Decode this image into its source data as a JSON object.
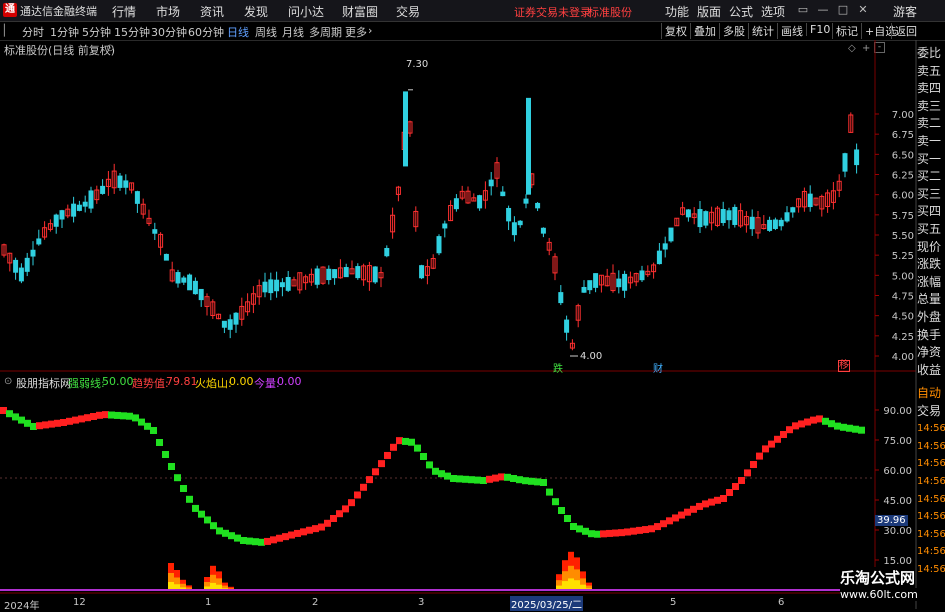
{
  "menubar": {
    "app_title": "通达信金融终端",
    "items": [
      "行情",
      "市场",
      "资讯",
      "发现",
      "问小达",
      "财富圈",
      "交易"
    ],
    "broker_status": "证券交易未登录",
    "broker_name": "标准股份",
    "right_items": [
      "功能",
      "版面",
      "公式",
      "选项"
    ],
    "guest": "游客"
  },
  "toolbar": {
    "periods": [
      "分时",
      "1分钟",
      "5分钟",
      "15分钟",
      "30分钟",
      "60分钟",
      "日线",
      "周线",
      "月线",
      "多周期",
      "更多"
    ],
    "active_period": "日线",
    "right_buttons": [
      "复权",
      "叠加",
      "多股",
      "统计",
      "画线",
      "F10",
      "标记",
      "+自选",
      "返回"
    ]
  },
  "main_chart": {
    "label": "标准股份(日线 前复权)",
    "y_ticks": [
      "7.00",
      "6.75",
      "6.50",
      "6.25",
      "6.00",
      "5.75",
      "5.50",
      "5.25",
      "5.00",
      "4.75",
      "4.50",
      "4.25",
      "4.00"
    ],
    "high_marker": "7.30",
    "low_marker": "4.00",
    "events": [
      {
        "text": "跌",
        "color": "#40e040"
      },
      {
        "text": "财",
        "color": "#40b0ff"
      },
      {
        "text": "移",
        "color": "#ff4040"
      }
    ]
  },
  "side_panel": {
    "items": [
      "委比",
      "卖五",
      "卖四",
      "卖三",
      "卖二",
      "卖一",
      "买一",
      "买二",
      "买三",
      "买四",
      "买五",
      "现价",
      "涨跌",
      "涨幅",
      "总量",
      "外盘",
      "换手",
      "净资",
      "收益"
    ],
    "bottom_items": [
      "自动",
      "交易"
    ],
    "times": [
      "14:56",
      "14:56",
      "14:56",
      "14:56",
      "14:56",
      "14:56",
      "14:56",
      "14:56",
      "14:56"
    ]
  },
  "indicator": {
    "name": "股朋指标网",
    "lines": [
      {
        "label": "强弱线:",
        "value": "50.00",
        "color": "#40e040"
      },
      {
        "label": "趋势值:",
        "value": "79.81",
        "color": "#ff4040"
      },
      {
        "label": "火焰山:",
        "value": "0.00",
        "color": "#ffd700"
      },
      {
        "label": "今量:",
        "value": "0.00",
        "color": "#d040ff"
      }
    ],
    "y_ticks": [
      "90.00",
      "75.00",
      "60.00",
      "45.00",
      "30.00",
      "15.00"
    ],
    "current_value": "39.96"
  },
  "x_axis": {
    "labels": [
      "2024年",
      "12",
      "1",
      "2",
      "3",
      "4",
      "5",
      "6"
    ],
    "active_label": "2025/03/25/二"
  },
  "watermark": {
    "title": "乐淘公式网",
    "url": "www.60lt.com"
  },
  "colors": {
    "up": "#ff3030",
    "down": "#30d0e0",
    "bg": "#000000",
    "grid": "#5a0000"
  }
}
